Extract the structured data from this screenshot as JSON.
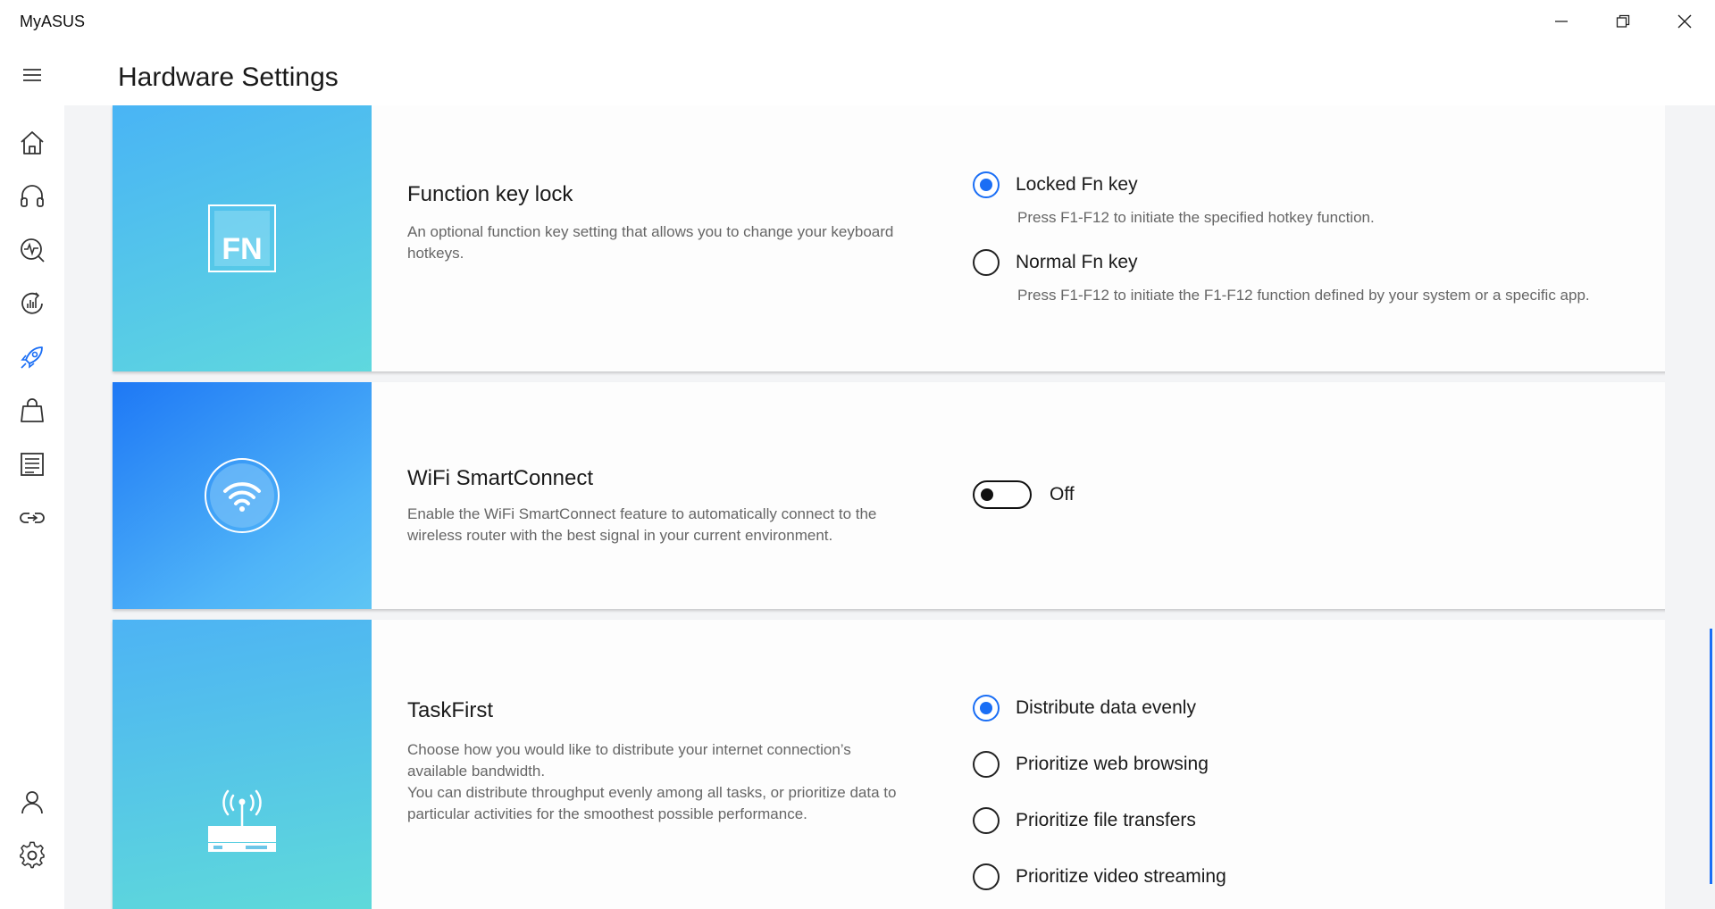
{
  "app": {
    "title": "MyASUS"
  },
  "window": {
    "minimize": "minimize",
    "restore": "restore",
    "close": "close"
  },
  "sidebar": {
    "items": [
      {
        "icon": "menu-icon"
      },
      {
        "icon": "home-icon"
      },
      {
        "icon": "headset-icon"
      },
      {
        "icon": "diagnostics-icon"
      },
      {
        "icon": "system-update-icon"
      },
      {
        "icon": "rocket-icon",
        "active": true
      },
      {
        "icon": "store-bag-icon"
      },
      {
        "icon": "news-icon"
      },
      {
        "icon": "link-icon"
      },
      {
        "icon": "user-icon"
      },
      {
        "icon": "gear-icon"
      }
    ]
  },
  "page": {
    "title": "Hardware Settings"
  },
  "cards": {
    "fn": {
      "icon_text": "FN",
      "title": "Function key lock",
      "desc": "An optional function key setting that allows you to change your keyboard hotkeys.",
      "options": [
        {
          "label": "Locked Fn key",
          "sub": "Press F1-F12 to initiate the specified hotkey function.",
          "checked": true
        },
        {
          "label": "Normal Fn key",
          "sub": "Press F1-F12 to initiate the F1-F12 function defined by your system or a specific app.",
          "checked": false
        }
      ]
    },
    "wifi": {
      "title": "WiFi SmartConnect",
      "desc": "Enable the WiFi SmartConnect feature to automatically connect to the wireless router with the best signal in your current environment.",
      "toggle_state": "Off"
    },
    "task": {
      "title": "TaskFirst",
      "desc1": "Choose how you would like to distribute your internet connection’s available bandwidth.",
      "desc2": "You can distribute throughput evenly among all tasks, or prioritize data to particular activities for the smoothest possible performance.",
      "options": [
        {
          "label": "Distribute data evenly",
          "checked": true
        },
        {
          "label": "Prioritize web browsing",
          "checked": false
        },
        {
          "label": "Prioritize file transfers",
          "checked": false
        },
        {
          "label": "Prioritize video streaming",
          "checked": false
        }
      ]
    }
  },
  "colors": {
    "accent": "#1a6ef5"
  }
}
